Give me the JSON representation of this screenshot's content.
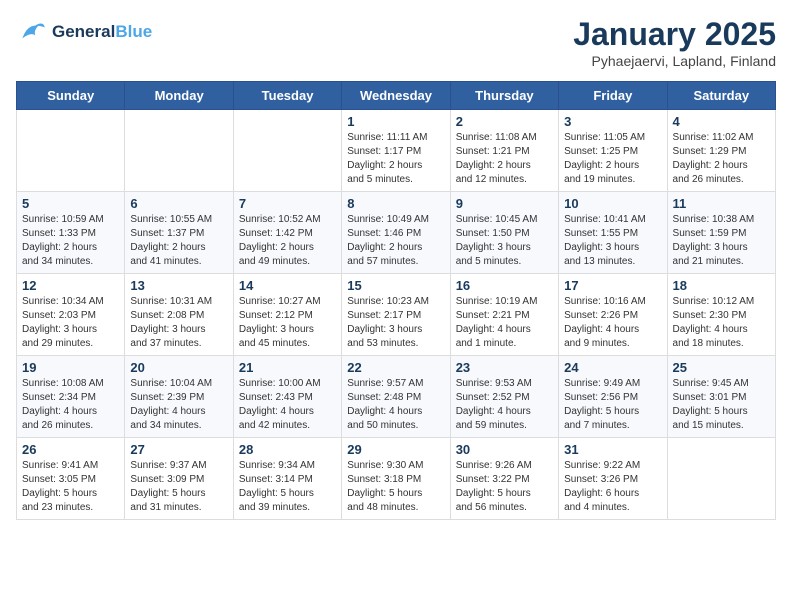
{
  "header": {
    "logo_line1": "General",
    "logo_line2": "Blue",
    "title": "January 2025",
    "subtitle": "Pyhaejaervi, Lapland, Finland"
  },
  "weekdays": [
    "Sunday",
    "Monday",
    "Tuesday",
    "Wednesday",
    "Thursday",
    "Friday",
    "Saturday"
  ],
  "weeks": [
    [
      {
        "day": "",
        "info": ""
      },
      {
        "day": "",
        "info": ""
      },
      {
        "day": "",
        "info": ""
      },
      {
        "day": "1",
        "info": "Sunrise: 11:11 AM\nSunset: 1:17 PM\nDaylight: 2 hours\nand 5 minutes."
      },
      {
        "day": "2",
        "info": "Sunrise: 11:08 AM\nSunset: 1:21 PM\nDaylight: 2 hours\nand 12 minutes."
      },
      {
        "day": "3",
        "info": "Sunrise: 11:05 AM\nSunset: 1:25 PM\nDaylight: 2 hours\nand 19 minutes."
      },
      {
        "day": "4",
        "info": "Sunrise: 11:02 AM\nSunset: 1:29 PM\nDaylight: 2 hours\nand 26 minutes."
      }
    ],
    [
      {
        "day": "5",
        "info": "Sunrise: 10:59 AM\nSunset: 1:33 PM\nDaylight: 2 hours\nand 34 minutes."
      },
      {
        "day": "6",
        "info": "Sunrise: 10:55 AM\nSunset: 1:37 PM\nDaylight: 2 hours\nand 41 minutes."
      },
      {
        "day": "7",
        "info": "Sunrise: 10:52 AM\nSunset: 1:42 PM\nDaylight: 2 hours\nand 49 minutes."
      },
      {
        "day": "8",
        "info": "Sunrise: 10:49 AM\nSunset: 1:46 PM\nDaylight: 2 hours\nand 57 minutes."
      },
      {
        "day": "9",
        "info": "Sunrise: 10:45 AM\nSunset: 1:50 PM\nDaylight: 3 hours\nand 5 minutes."
      },
      {
        "day": "10",
        "info": "Sunrise: 10:41 AM\nSunset: 1:55 PM\nDaylight: 3 hours\nand 13 minutes."
      },
      {
        "day": "11",
        "info": "Sunrise: 10:38 AM\nSunset: 1:59 PM\nDaylight: 3 hours\nand 21 minutes."
      }
    ],
    [
      {
        "day": "12",
        "info": "Sunrise: 10:34 AM\nSunset: 2:03 PM\nDaylight: 3 hours\nand 29 minutes."
      },
      {
        "day": "13",
        "info": "Sunrise: 10:31 AM\nSunset: 2:08 PM\nDaylight: 3 hours\nand 37 minutes."
      },
      {
        "day": "14",
        "info": "Sunrise: 10:27 AM\nSunset: 2:12 PM\nDaylight: 3 hours\nand 45 minutes."
      },
      {
        "day": "15",
        "info": "Sunrise: 10:23 AM\nSunset: 2:17 PM\nDaylight: 3 hours\nand 53 minutes."
      },
      {
        "day": "16",
        "info": "Sunrise: 10:19 AM\nSunset: 2:21 PM\nDaylight: 4 hours\nand 1 minute."
      },
      {
        "day": "17",
        "info": "Sunrise: 10:16 AM\nSunset: 2:26 PM\nDaylight: 4 hours\nand 9 minutes."
      },
      {
        "day": "18",
        "info": "Sunrise: 10:12 AM\nSunset: 2:30 PM\nDaylight: 4 hours\nand 18 minutes."
      }
    ],
    [
      {
        "day": "19",
        "info": "Sunrise: 10:08 AM\nSunset: 2:34 PM\nDaylight: 4 hours\nand 26 minutes."
      },
      {
        "day": "20",
        "info": "Sunrise: 10:04 AM\nSunset: 2:39 PM\nDaylight: 4 hours\nand 34 minutes."
      },
      {
        "day": "21",
        "info": "Sunrise: 10:00 AM\nSunset: 2:43 PM\nDaylight: 4 hours\nand 42 minutes."
      },
      {
        "day": "22",
        "info": "Sunrise: 9:57 AM\nSunset: 2:48 PM\nDaylight: 4 hours\nand 50 minutes."
      },
      {
        "day": "23",
        "info": "Sunrise: 9:53 AM\nSunset: 2:52 PM\nDaylight: 4 hours\nand 59 minutes."
      },
      {
        "day": "24",
        "info": "Sunrise: 9:49 AM\nSunset: 2:56 PM\nDaylight: 5 hours\nand 7 minutes."
      },
      {
        "day": "25",
        "info": "Sunrise: 9:45 AM\nSunset: 3:01 PM\nDaylight: 5 hours\nand 15 minutes."
      }
    ],
    [
      {
        "day": "26",
        "info": "Sunrise: 9:41 AM\nSunset: 3:05 PM\nDaylight: 5 hours\nand 23 minutes."
      },
      {
        "day": "27",
        "info": "Sunrise: 9:37 AM\nSunset: 3:09 PM\nDaylight: 5 hours\nand 31 minutes."
      },
      {
        "day": "28",
        "info": "Sunrise: 9:34 AM\nSunset: 3:14 PM\nDaylight: 5 hours\nand 39 minutes."
      },
      {
        "day": "29",
        "info": "Sunrise: 9:30 AM\nSunset: 3:18 PM\nDaylight: 5 hours\nand 48 minutes."
      },
      {
        "day": "30",
        "info": "Sunrise: 9:26 AM\nSunset: 3:22 PM\nDaylight: 5 hours\nand 56 minutes."
      },
      {
        "day": "31",
        "info": "Sunrise: 9:22 AM\nSunset: 3:26 PM\nDaylight: 6 hours\nand 4 minutes."
      },
      {
        "day": "",
        "info": ""
      }
    ]
  ]
}
